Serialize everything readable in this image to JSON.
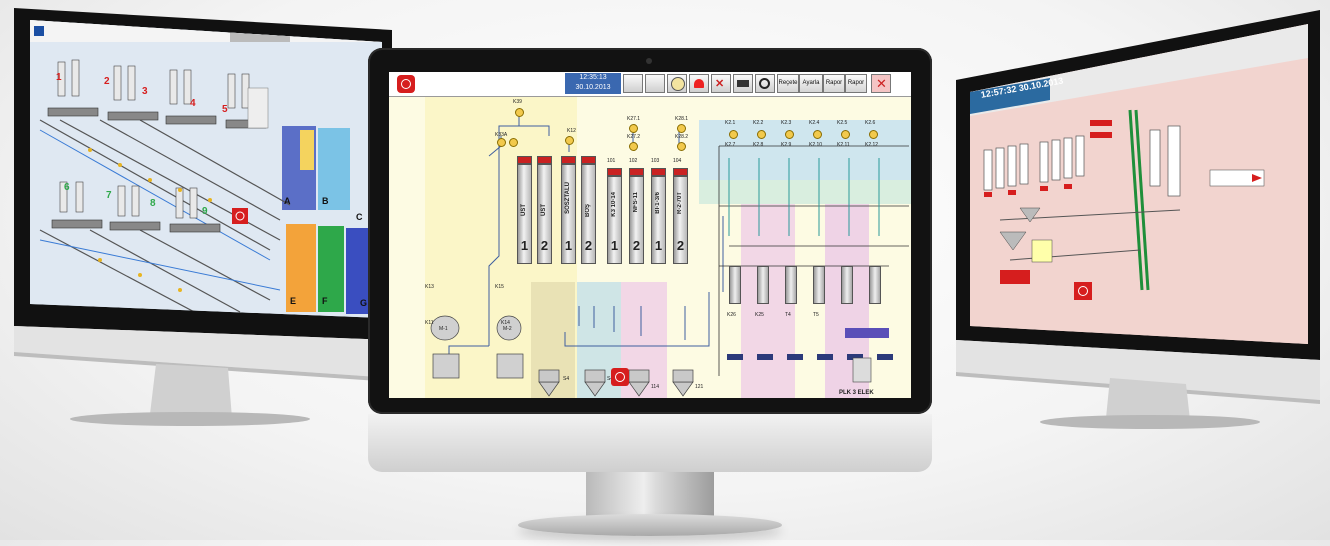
{
  "center": {
    "clock_time": "12:35:13",
    "clock_date": "30.10.2013",
    "toolbar_text_buttons": [
      "Reçete",
      "Ayarla",
      "Rapor",
      "Rapor"
    ],
    "toolbar_icons": [
      "computer-icon",
      "folder-icon",
      "globe-icon",
      "alarm-bell-icon",
      "tools-icon",
      "keyboard-icon",
      "gauge-icon"
    ],
    "top_labels": [
      "K39",
      "K33A",
      "K12",
      "K27.1",
      "K28.1",
      "K27.2",
      "K28.2"
    ],
    "silos": [
      {
        "name": "ÜST",
        "num": "1"
      },
      {
        "name": "ÜST",
        "num": "2"
      },
      {
        "name": "SOSZTALÜ",
        "num": "1"
      },
      {
        "name": "BOŞ",
        "num": "2"
      },
      {
        "name": "K3 10-14",
        "num": "1"
      },
      {
        "name": "NFS-11",
        "num": "2"
      },
      {
        "name": "BI-1-3/6",
        "num": "1"
      },
      {
        "name": "R-2-70T",
        "num": "2"
      }
    ],
    "silo_codes": [
      "101",
      "102",
      "103",
      "104"
    ],
    "k_labels": [
      "K2.1",
      "K2.2",
      "K2.3",
      "K2.4",
      "K2.5",
      "K2.6",
      "K2.7",
      "K2.8",
      "K2.9",
      "K2.10",
      "K2.11",
      "K2.12"
    ],
    "bottom_labels": [
      "K13",
      "K15",
      "K11",
      "K14",
      "M-1",
      "M-2",
      "S4",
      "S4",
      "114",
      "121"
    ],
    "mix_labels": [
      "K26",
      "K25",
      "T4",
      "T5"
    ],
    "footer_label": "PLK 3 ELEK"
  },
  "left": {
    "line_numbers": [
      "1",
      "2",
      "3",
      "4",
      "5",
      "6",
      "7",
      "8",
      "9"
    ],
    "side_letters": [
      "A",
      "B",
      "C",
      "E",
      "F",
      "G"
    ]
  },
  "right": {
    "clock": "12:57:32  30.10.2013"
  },
  "colors": {
    "center_bg": "#fdfbe3",
    "accent_red": "#d61e1e",
    "clock_blue": "#3a68b0"
  }
}
